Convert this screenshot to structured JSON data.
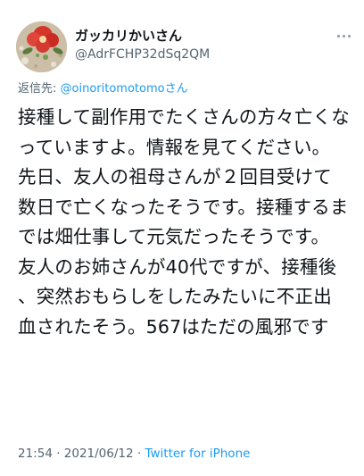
{
  "header": {
    "display_name": "ガッカリかいさん",
    "handle": "@AdrFCHP32dSq2QM",
    "more_icon": "more-dots-icon",
    "avatar_icon": "floral-avatar-icon"
  },
  "reply": {
    "prefix": "返信先:",
    "mention": "@oinoritomotomoさん"
  },
  "body": {
    "lines": [
      "接種して副作用でたくさんの方々亡くなっていますよ。情報を見てください。",
      "先日、友人の祖母さんが２回目受けて数日で亡くなったそうです。接種するまでは畑仕事して元気だったそうです。",
      "友人のお姉さんが40代ですが、接種後、突然おもらしをしたみたいに不正出血されたそう。567はただの風邪です"
    ]
  },
  "meta": {
    "time": "21:54",
    "separator1": " · ",
    "date": "2021/06/12",
    "separator2": " · ",
    "source": "Twitter for iPhone"
  },
  "colors": {
    "text": "#0f1419",
    "secondary": "#536471",
    "link": "#1d9bf0"
  }
}
